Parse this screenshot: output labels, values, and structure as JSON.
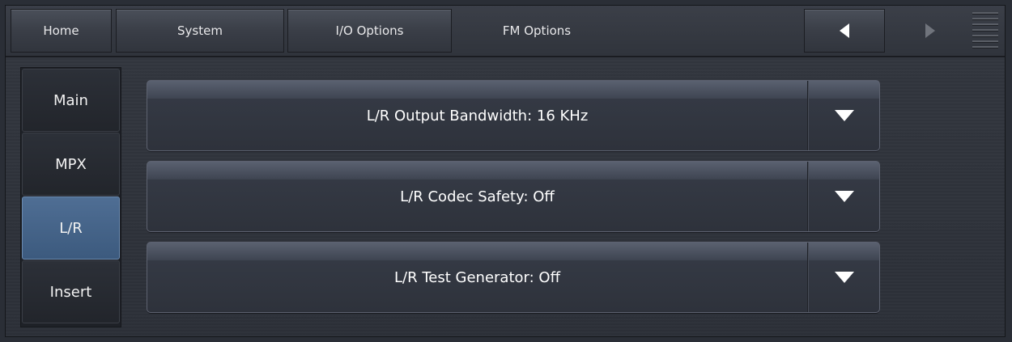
{
  "top_tabs": [
    {
      "label": "Home"
    },
    {
      "label": "System"
    },
    {
      "label": "I/O Options"
    },
    {
      "label": "FM Options"
    }
  ],
  "nav": {
    "back_icon": "triangle-left-icon",
    "forward_icon": "triangle-right-icon",
    "menu_icon": "hamburger-icon"
  },
  "sidebar": {
    "items": [
      {
        "label": "Main"
      },
      {
        "label": "MPX"
      },
      {
        "label": "L/R",
        "active": true
      },
      {
        "label": "Insert"
      }
    ]
  },
  "dropdowns": [
    {
      "label": "L/R Output Bandwidth: 16 KHz"
    },
    {
      "label": "L/R Codec Safety: Off"
    },
    {
      "label": "L/R Test Generator: Off"
    }
  ],
  "colors": {
    "active_tab": "#456587",
    "background": "#2f333b"
  }
}
